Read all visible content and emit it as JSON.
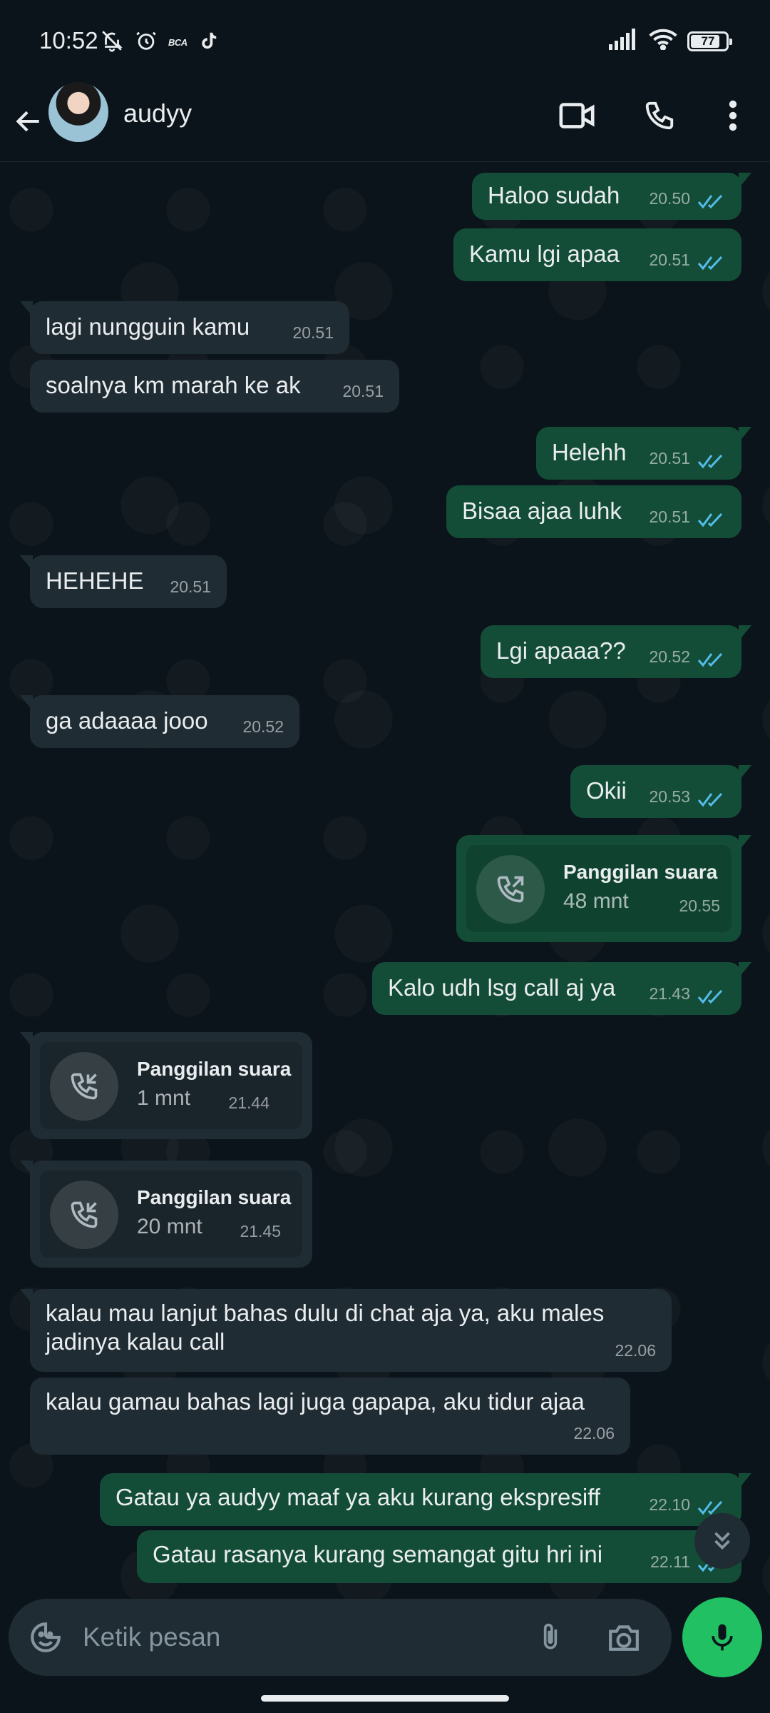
{
  "status_bar": {
    "time": "10:52",
    "battery": "77",
    "battery_level": 0.77,
    "icons": [
      "mute-bell-icon",
      "alarm-icon",
      "bca-app-icon",
      "tiktok-icon",
      "signal-icon",
      "wifi-icon",
      "battery-icon"
    ],
    "bca_label": "BCA"
  },
  "header": {
    "contact_name": "audyy",
    "icons": [
      "back-arrow-icon",
      "video-call-icon",
      "voice-call-icon",
      "more-vert-icon"
    ]
  },
  "messages": [
    {
      "dir": "out",
      "text": "Haloo sudah",
      "time": "20.50",
      "read": true
    },
    {
      "dir": "out",
      "text": "Kamu lgi apaa",
      "time": "20.51",
      "read": true
    },
    {
      "dir": "in",
      "text": "lagi nungguin kamu",
      "time": "20.51"
    },
    {
      "dir": "in",
      "text": "soalnya km marah ke ak",
      "time": "20.51"
    },
    {
      "dir": "out",
      "text": "Helehh",
      "time": "20.51",
      "read": true
    },
    {
      "dir": "out",
      "text": "Bisaa ajaa luhk",
      "time": "20.51",
      "read": true
    },
    {
      "dir": "in",
      "text": "HEHEHE",
      "time": "20.51"
    },
    {
      "dir": "out",
      "text": "Lgi apaaa??",
      "time": "20.52",
      "read": true
    },
    {
      "dir": "in",
      "text": "ga adaaaa jooo",
      "time": "20.52"
    },
    {
      "dir": "out",
      "text": "Okii",
      "time": "20.53",
      "read": true
    },
    {
      "dir": "out",
      "type": "call",
      "title": "Panggilan suara",
      "duration": "48 mnt",
      "time": "20.55"
    },
    {
      "dir": "out",
      "text": "Kalo udh lsg call aj ya",
      "time": "21.43",
      "read": true
    },
    {
      "dir": "in",
      "type": "call",
      "title": "Panggilan suara",
      "duration": "1 mnt",
      "time": "21.44"
    },
    {
      "dir": "in",
      "type": "call",
      "title": "Panggilan suara",
      "duration": "20 mnt",
      "time": "21.45"
    },
    {
      "dir": "in",
      "text": "kalau mau lanjut bahas dulu di chat aja ya, aku males jadinya kalau call",
      "time": "22.06"
    },
    {
      "dir": "in",
      "text": "kalau gamau bahas lagi juga gapapa, aku tidur ajaa",
      "time": "22.06"
    },
    {
      "dir": "out",
      "text": "Gatau ya audyy maaf ya aku kurang ekspresiff",
      "time": "22.10",
      "read": true
    },
    {
      "dir": "out",
      "text": "Gatau rasanya kurang semangat gitu hri ini",
      "time": "22.11",
      "read": true
    }
  ],
  "composer": {
    "placeholder": "Ketik pesan",
    "icons": [
      "emoji-icon",
      "attach-icon",
      "camera-icon",
      "mic-icon"
    ]
  },
  "colors": {
    "background": "#0b141a",
    "outgoing_bubble": "#144d37",
    "incoming_bubble": "#202c33",
    "read_tick": "#53bdeb",
    "accent_green": "#21c063"
  }
}
